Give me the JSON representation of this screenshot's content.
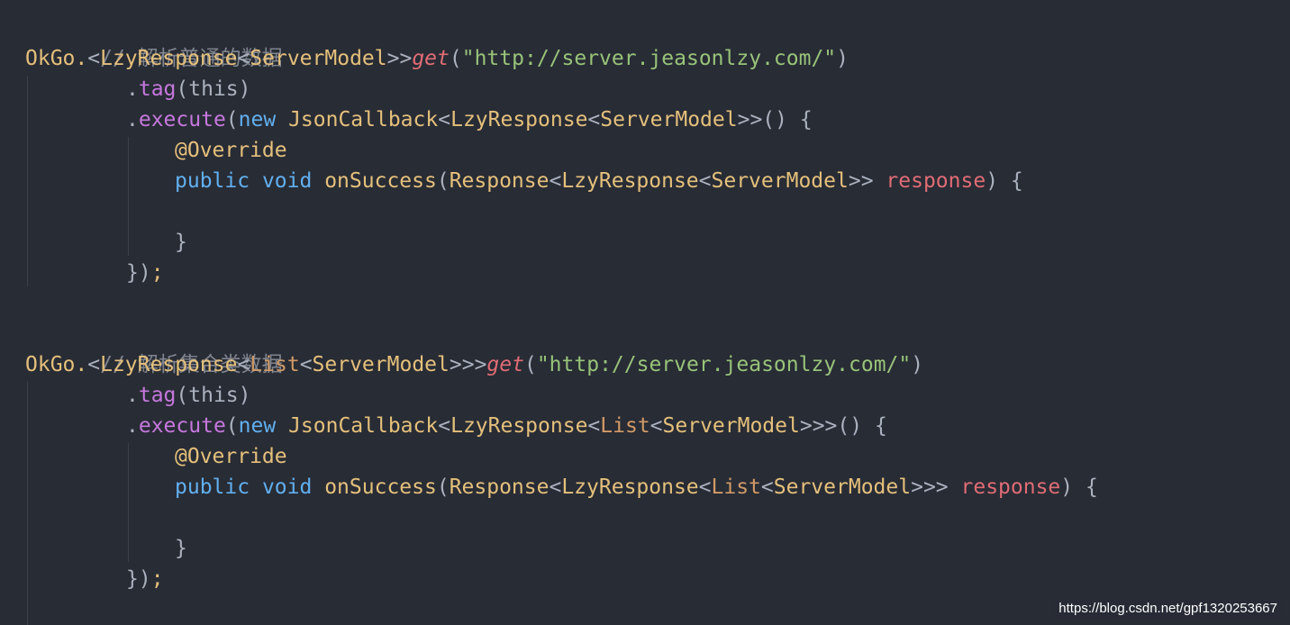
{
  "code": {
    "line1": "// 解析普通的数据",
    "line2": {
      "okgo": "OkGo.",
      "lt": "<",
      "lzy": "LzyResponse",
      "lt2": "<",
      "model": "ServerModel",
      "gtgt": ">>",
      "get": "get",
      "open": "(",
      "url": "\"http://server.jeasonlzy.com/\"",
      "close": ")"
    },
    "line3": {
      "dot": ".",
      "tag": "tag",
      "args": "(this)"
    },
    "line4": {
      "dot": ".",
      "execute": "execute",
      "open": "(",
      "new": "new",
      "cb": "JsonCallback",
      "lt": "<",
      "lzy": "LzyResponse",
      "lt2": "<",
      "model": "ServerModel",
      "rest": ">>() {"
    },
    "line5": "@Override",
    "line6": {
      "public": "public",
      "void": "void",
      "fn": "onSuccess",
      "open": "(",
      "resp": "Response",
      "lt": "<",
      "lzy": "LzyResponse",
      "lt2": "<",
      "model": "ServerModel",
      "gt": ">>",
      "param": "response",
      "rest": ") {"
    },
    "line8": "}",
    "line9": {
      "close": "})",
      "semi": ";"
    },
    "line11": "// 解析集合类数据",
    "line12": {
      "okgo": "OkGo.",
      "lt": "<",
      "lzy": "LzyResponse",
      "lt2": "<",
      "list": "List",
      "lt3": "<",
      "model": "ServerModel",
      "gt": ">>>",
      "get": "get",
      "open": "(",
      "url": "\"http://server.jeasonlzy.com/\"",
      "close": ")"
    },
    "line13": {
      "dot": ".",
      "tag": "tag",
      "args": "(this)"
    },
    "line14": {
      "dot": ".",
      "execute": "execute",
      "open": "(",
      "new": "new",
      "cb": "JsonCallback",
      "lt": "<",
      "lzy": "LzyResponse",
      "lt2": "<",
      "list": "List",
      "lt3": "<",
      "model": "ServerModel",
      "rest": ">>>() {"
    },
    "line15": "@Override",
    "line16": {
      "public": "public",
      "void": "void",
      "fn": "onSuccess",
      "open": "(",
      "resp": "Response",
      "lt": "<",
      "lzy": "LzyResponse",
      "lt2": "<",
      "list": "List",
      "lt3": "<",
      "model": "ServerModel",
      "gt": ">>>",
      "param": "response",
      "rest": ") {"
    },
    "line18": "}",
    "line19": {
      "close": "})",
      "semi": ";"
    }
  },
  "watermark": "https://blog.csdn.net/gpf1320253667",
  "colors": {
    "background": "#282c35",
    "comment": "#7f848e",
    "class": "#e5c07b",
    "string": "#98c379",
    "keyword": "#61afef",
    "method": "#c678dd",
    "param": "#e06c75"
  }
}
